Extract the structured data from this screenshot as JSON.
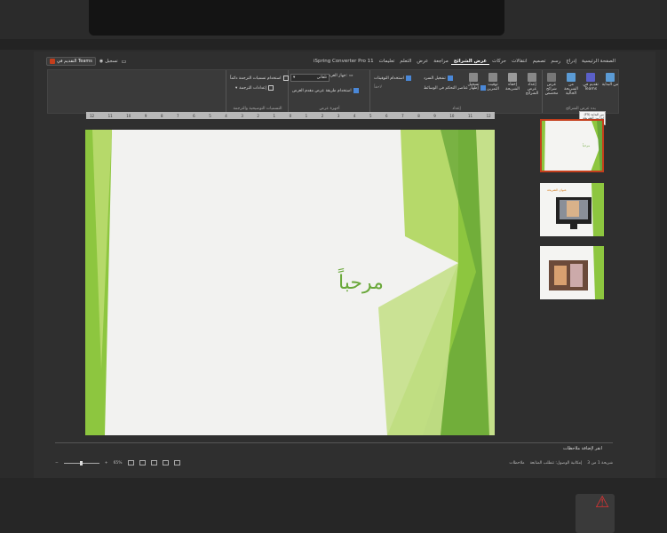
{
  "ribbon": {
    "tabs": [
      {
        "label": "الصفحة الرئيسية",
        "active": false
      },
      {
        "label": "إدراج",
        "active": false
      },
      {
        "label": "رسم",
        "active": false
      },
      {
        "label": "تصميم",
        "active": false
      },
      {
        "label": "انتقالات",
        "active": false
      },
      {
        "label": "حركات",
        "active": false
      },
      {
        "label": "عرض الشرائح",
        "active": true
      },
      {
        "label": "مراجعة",
        "active": false
      },
      {
        "label": "عرض",
        "active": false
      },
      {
        "label": "التعلم",
        "active": false
      },
      {
        "label": "تعليمات",
        "active": false
      },
      {
        "label": "iSpring Converter Pro 11",
        "active": false
      }
    ],
    "share": {
      "teams_label": "التقديم في Teams",
      "record_label": "تسجيل"
    },
    "groups": {
      "start": {
        "label": "بدء عرض الشرائح",
        "from_beginning": "من البداية",
        "from_current": "من الشريحة الحالية",
        "present_teams": "تقديم في Teams",
        "custom_show": "عرض شرائح مخصص"
      },
      "setup": {
        "label": "إعداد",
        "setup_show": "إعداد عرض الشرائح",
        "hide_slide": "إخفاء الشريحة",
        "rehearse": "توقيت التمرين",
        "record": "تسجيل",
        "play_narrations": "تشغيل السرد",
        "use_timings": "استخدام التوقيتات",
        "show_media_controls": "إظهار عناصر التحكم في الوسائط",
        "dimmed": "لاحقاً"
      },
      "monitors": {
        "label": "أجهزة عرض",
        "monitor_label": "جهاز العرض:",
        "monitor_value": "تلقائي",
        "presenter_view": "استخدام طريقة عرض مقدم العرض"
      },
      "captions": {
        "label": "التسميات التوضيحية والترجمة",
        "always_use": "استخدام تسميات الترجمة دائماً",
        "settings": "إعدادات الترجمة"
      }
    },
    "ruler_ticks": [
      "12",
      "11",
      "10",
      "9",
      "8",
      "7",
      "6",
      "5",
      "4",
      "3",
      "2",
      "1",
      "0",
      "1",
      "2",
      "3",
      "4",
      "5",
      "6",
      "7",
      "8",
      "9",
      "10",
      "11",
      "12"
    ]
  },
  "slide": {
    "title": "مرحباً",
    "theme_colors": {
      "green_light": "#c5e08a",
      "green_mid": "#8dc63f",
      "green_dark": "#6aa83a",
      "background": "#f2f2f0"
    }
  },
  "thumbnails": [
    {
      "number": "1",
      "title": "مرحباً",
      "selected": true
    },
    {
      "number": "2",
      "title": "عنوان الشريحة",
      "selected": false
    },
    {
      "number": "3",
      "title": "",
      "selected": false
    }
  ],
  "tooltip": {
    "line1": "من البداية (F5)",
    "line2": "ابدأ من الشريحة"
  },
  "notes": {
    "placeholder": "انقر لإضافة ملاحظات"
  },
  "status": {
    "slide_info": "شريحة 1 من 3",
    "accessibility": "إمكانية الوصول: تتطلب المتابعة",
    "notes_label": "ملاحظات",
    "zoom": "65%"
  },
  "accent": "#c43e1c"
}
